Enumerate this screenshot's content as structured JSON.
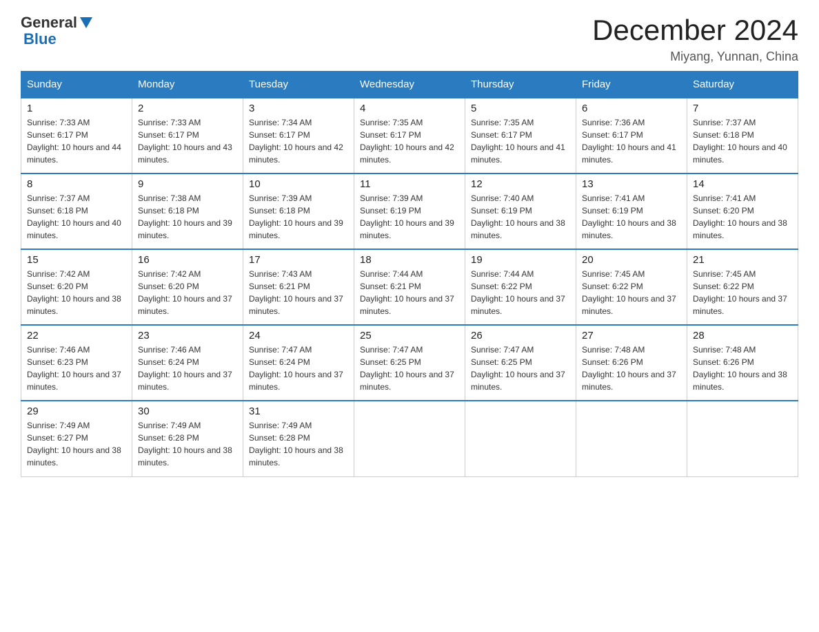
{
  "header": {
    "logo_general": "General",
    "logo_blue": "Blue",
    "month": "December 2024",
    "location": "Miyang, Yunnan, China"
  },
  "days_of_week": [
    "Sunday",
    "Monday",
    "Tuesday",
    "Wednesday",
    "Thursday",
    "Friday",
    "Saturday"
  ],
  "weeks": [
    [
      {
        "day": "1",
        "sunrise": "7:33 AM",
        "sunset": "6:17 PM",
        "daylight": "10 hours and 44 minutes."
      },
      {
        "day": "2",
        "sunrise": "7:33 AM",
        "sunset": "6:17 PM",
        "daylight": "10 hours and 43 minutes."
      },
      {
        "day": "3",
        "sunrise": "7:34 AM",
        "sunset": "6:17 PM",
        "daylight": "10 hours and 42 minutes."
      },
      {
        "day": "4",
        "sunrise": "7:35 AM",
        "sunset": "6:17 PM",
        "daylight": "10 hours and 42 minutes."
      },
      {
        "day": "5",
        "sunrise": "7:35 AM",
        "sunset": "6:17 PM",
        "daylight": "10 hours and 41 minutes."
      },
      {
        "day": "6",
        "sunrise": "7:36 AM",
        "sunset": "6:17 PM",
        "daylight": "10 hours and 41 minutes."
      },
      {
        "day": "7",
        "sunrise": "7:37 AM",
        "sunset": "6:18 PM",
        "daylight": "10 hours and 40 minutes."
      }
    ],
    [
      {
        "day": "8",
        "sunrise": "7:37 AM",
        "sunset": "6:18 PM",
        "daylight": "10 hours and 40 minutes."
      },
      {
        "day": "9",
        "sunrise": "7:38 AM",
        "sunset": "6:18 PM",
        "daylight": "10 hours and 39 minutes."
      },
      {
        "day": "10",
        "sunrise": "7:39 AM",
        "sunset": "6:18 PM",
        "daylight": "10 hours and 39 minutes."
      },
      {
        "day": "11",
        "sunrise": "7:39 AM",
        "sunset": "6:19 PM",
        "daylight": "10 hours and 39 minutes."
      },
      {
        "day": "12",
        "sunrise": "7:40 AM",
        "sunset": "6:19 PM",
        "daylight": "10 hours and 38 minutes."
      },
      {
        "day": "13",
        "sunrise": "7:41 AM",
        "sunset": "6:19 PM",
        "daylight": "10 hours and 38 minutes."
      },
      {
        "day": "14",
        "sunrise": "7:41 AM",
        "sunset": "6:20 PM",
        "daylight": "10 hours and 38 minutes."
      }
    ],
    [
      {
        "day": "15",
        "sunrise": "7:42 AM",
        "sunset": "6:20 PM",
        "daylight": "10 hours and 38 minutes."
      },
      {
        "day": "16",
        "sunrise": "7:42 AM",
        "sunset": "6:20 PM",
        "daylight": "10 hours and 37 minutes."
      },
      {
        "day": "17",
        "sunrise": "7:43 AM",
        "sunset": "6:21 PM",
        "daylight": "10 hours and 37 minutes."
      },
      {
        "day": "18",
        "sunrise": "7:44 AM",
        "sunset": "6:21 PM",
        "daylight": "10 hours and 37 minutes."
      },
      {
        "day": "19",
        "sunrise": "7:44 AM",
        "sunset": "6:22 PM",
        "daylight": "10 hours and 37 minutes."
      },
      {
        "day": "20",
        "sunrise": "7:45 AM",
        "sunset": "6:22 PM",
        "daylight": "10 hours and 37 minutes."
      },
      {
        "day": "21",
        "sunrise": "7:45 AM",
        "sunset": "6:22 PM",
        "daylight": "10 hours and 37 minutes."
      }
    ],
    [
      {
        "day": "22",
        "sunrise": "7:46 AM",
        "sunset": "6:23 PM",
        "daylight": "10 hours and 37 minutes."
      },
      {
        "day": "23",
        "sunrise": "7:46 AM",
        "sunset": "6:24 PM",
        "daylight": "10 hours and 37 minutes."
      },
      {
        "day": "24",
        "sunrise": "7:47 AM",
        "sunset": "6:24 PM",
        "daylight": "10 hours and 37 minutes."
      },
      {
        "day": "25",
        "sunrise": "7:47 AM",
        "sunset": "6:25 PM",
        "daylight": "10 hours and 37 minutes."
      },
      {
        "day": "26",
        "sunrise": "7:47 AM",
        "sunset": "6:25 PM",
        "daylight": "10 hours and 37 minutes."
      },
      {
        "day": "27",
        "sunrise": "7:48 AM",
        "sunset": "6:26 PM",
        "daylight": "10 hours and 37 minutes."
      },
      {
        "day": "28",
        "sunrise": "7:48 AM",
        "sunset": "6:26 PM",
        "daylight": "10 hours and 38 minutes."
      }
    ],
    [
      {
        "day": "29",
        "sunrise": "7:49 AM",
        "sunset": "6:27 PM",
        "daylight": "10 hours and 38 minutes."
      },
      {
        "day": "30",
        "sunrise": "7:49 AM",
        "sunset": "6:28 PM",
        "daylight": "10 hours and 38 minutes."
      },
      {
        "day": "31",
        "sunrise": "7:49 AM",
        "sunset": "6:28 PM",
        "daylight": "10 hours and 38 minutes."
      },
      null,
      null,
      null,
      null
    ]
  ]
}
